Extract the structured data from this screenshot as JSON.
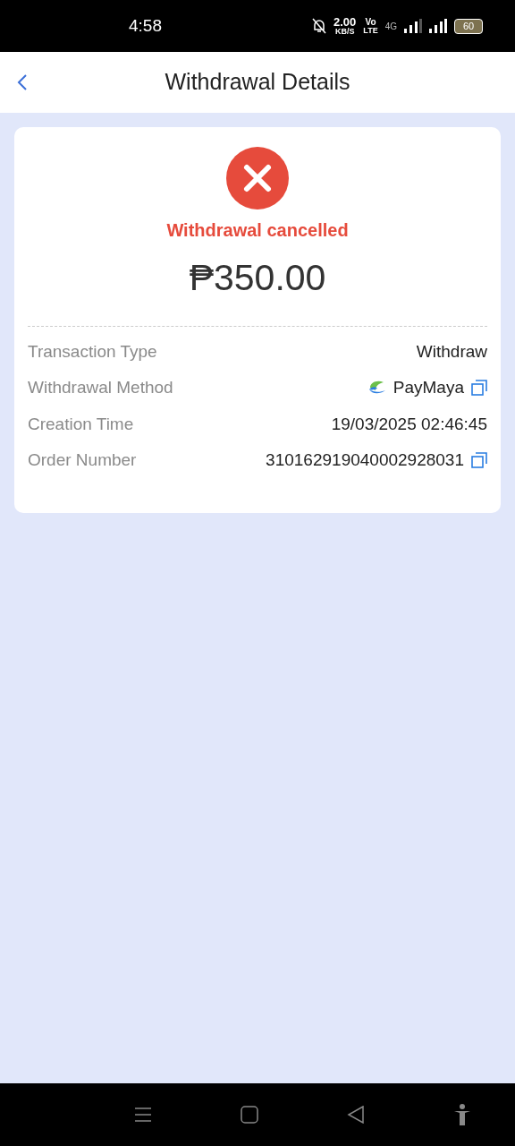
{
  "status_bar": {
    "time": "4:58",
    "speed": "2.00",
    "speed_unit": "KB/S",
    "volte_top": "Vo",
    "volte_bottom": "LTE",
    "network": "4G",
    "battery": "60"
  },
  "header": {
    "title": "Withdrawal Details"
  },
  "status": {
    "label": "Withdrawal cancelled",
    "amount": "₱350.00"
  },
  "rows": [
    {
      "kind": "plain",
      "label": "Transaction Type",
      "value": "Withdraw"
    },
    {
      "kind": "method",
      "label": "Withdrawal Method",
      "value": "PayMaya"
    },
    {
      "kind": "plain",
      "label": "Creation Time",
      "value": "19/03/2025 02:46:45"
    },
    {
      "kind": "copy",
      "label": "Order Number",
      "value": "310162919040002928031"
    }
  ]
}
